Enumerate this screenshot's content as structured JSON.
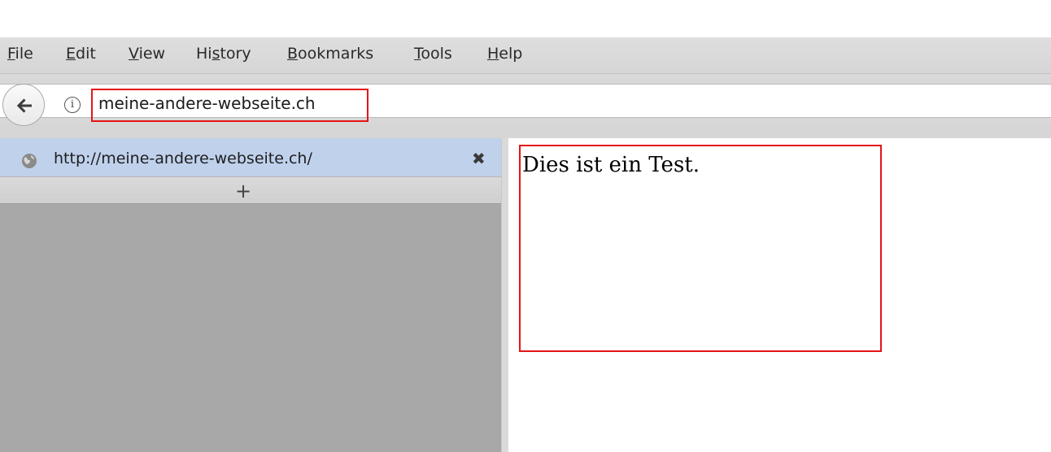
{
  "menubar": {
    "file": {
      "acc": "F",
      "rest": "ile"
    },
    "edit": {
      "acc": "E",
      "rest": "dit"
    },
    "view": {
      "acc": "V",
      "rest": "iew"
    },
    "history": {
      "pre": "Hi",
      "acc": "s",
      "rest": "tory"
    },
    "bookmarks": {
      "acc": "B",
      "rest": "ookmarks"
    },
    "tools": {
      "acc": "T",
      "rest": "ools"
    },
    "help": {
      "acc": "H",
      "rest": "elp"
    }
  },
  "navbar": {
    "url": "meine-andere-webseite.ch",
    "info_glyph": "i",
    "back_icon": "back-arrow-icon"
  },
  "sidebar": {
    "tabs": [
      {
        "title": "http://meine-andere-webseite.ch/",
        "close_glyph": "✖",
        "favicon": "globe-icon"
      }
    ],
    "new_tab_glyph": "+"
  },
  "content": {
    "text": "Dies ist ein Test."
  },
  "colors": {
    "highlight": "#e41515",
    "selected_tab": "#c0d1ec",
    "sidebar_bg": "#a8a8a8"
  }
}
